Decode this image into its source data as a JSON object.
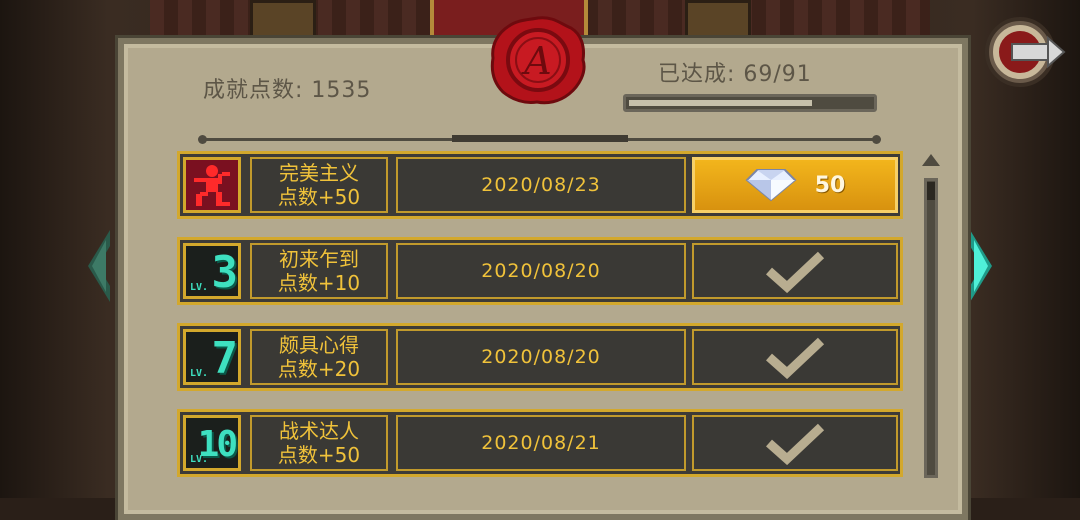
{
  "header": {
    "points_label": "成就点数: 1535",
    "achieved_label": "已达成: 69/91",
    "progress_fraction": 0.758
  },
  "seal": {
    "letter": "A"
  },
  "achievements": [
    {
      "icon": "perfectionist-figure-icon",
      "name": "完美主义",
      "points": "点数+50",
      "date": "2020/08/23",
      "reward_type": "gem",
      "reward_count": "50"
    },
    {
      "icon": "level-badge-icon",
      "level": "3",
      "level_tag": "LV.",
      "name": "初来乍到",
      "points": "点数+10",
      "date": "2020/08/20",
      "reward_type": "claimed"
    },
    {
      "icon": "level-badge-icon",
      "level": "7",
      "level_tag": "LV.",
      "name": "颇具心得",
      "points": "点数+20",
      "date": "2020/08/20",
      "reward_type": "claimed"
    },
    {
      "icon": "level-badge-icon",
      "level": "10",
      "level_tag": "LV.",
      "name": "战术达人",
      "points": "点数+50",
      "date": "2020/08/21",
      "reward_type": "claimed"
    }
  ],
  "colors": {
    "accent_gold": "#d3a82c",
    "text_gold": "#f0c23a",
    "teal": "#3ee0c0",
    "seal_red": "#b3121a"
  }
}
